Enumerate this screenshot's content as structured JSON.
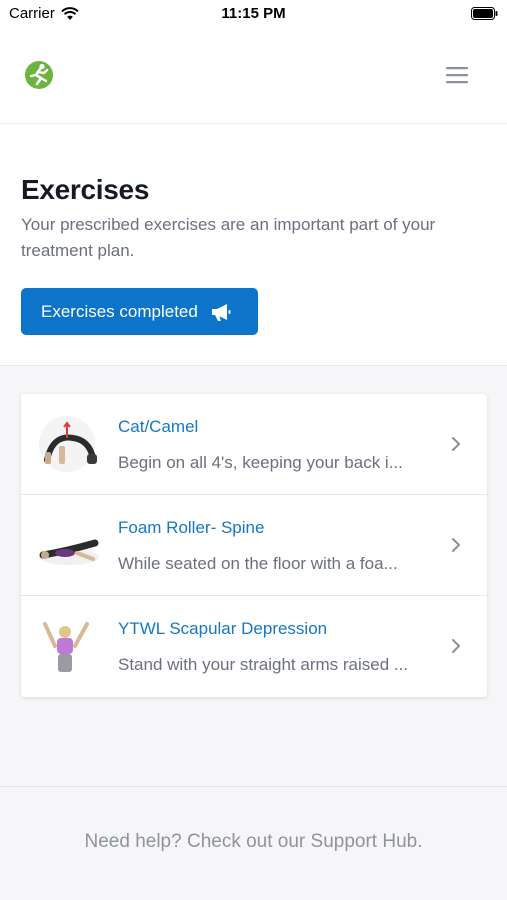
{
  "status_bar": {
    "carrier": "Carrier",
    "time": "11:15 PM"
  },
  "header": {
    "logo_icon": "runner-logo-icon",
    "menu_icon": "hamburger-menu-icon",
    "brand_color": "#6db33f"
  },
  "intro": {
    "title": "Exercises",
    "subtitle": "Your prescribed exercises are an important part of your treatment plan.",
    "button_label": "Exercises completed",
    "button_icon": "megaphone-icon",
    "button_color": "#0d74c9"
  },
  "exercises": [
    {
      "title": "Cat/Camel",
      "description": "Begin on all 4's, keeping your back i...",
      "thumbnail_icon": "cat-camel-exercise-icon"
    },
    {
      "title": "Foam Roller- Spine",
      "description": "While seated on the floor with a foa...",
      "thumbnail_icon": "foam-roller-exercise-icon"
    },
    {
      "title": "YTWL Scapular Depression",
      "description": "Stand with your straight arms raised ...",
      "thumbnail_icon": "scapular-depression-exercise-icon"
    }
  ],
  "footer": {
    "help_text": "Need help? Check out our Support Hub."
  }
}
